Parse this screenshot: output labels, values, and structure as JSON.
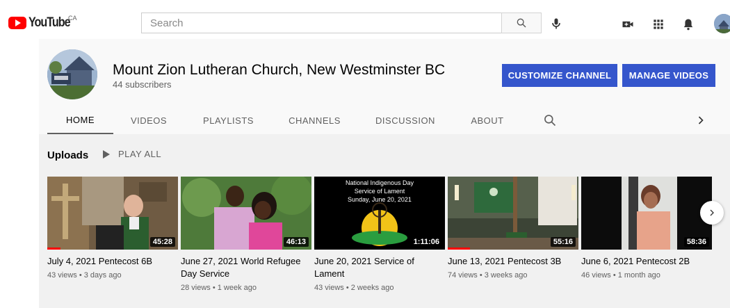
{
  "header": {
    "logo_text": "YouTube",
    "region": "CA",
    "search_placeholder": "Search"
  },
  "channel": {
    "name": "Mount Zion Lutheran Church, New Westminster BC",
    "subscribers": "44 subscribers",
    "customize_label": "CUSTOMIZE CHANNEL",
    "manage_label": "MANAGE VIDEOS"
  },
  "tabs": [
    {
      "label": "HOME",
      "active": true
    },
    {
      "label": "VIDEOS"
    },
    {
      "label": "PLAYLISTS"
    },
    {
      "label": "CHANNELS"
    },
    {
      "label": "DISCUSSION"
    },
    {
      "label": "ABOUT"
    }
  ],
  "uploads": {
    "title": "Uploads",
    "play_all": "PLAY ALL"
  },
  "videos": [
    {
      "title": "July 4, 2021 Pentecost 6B",
      "meta": "43 views • 3 days ago",
      "duration": "45:28",
      "watched": 0.1
    },
    {
      "title": "June 27, 2021 World Refugee Day Service",
      "meta": "28 views • 1 week ago",
      "duration": "46:13"
    },
    {
      "title": "June 20, 2021 Service of Lament",
      "meta": "43 views • 2 weeks ago",
      "duration": "1:11:06",
      "thumb_text": [
        "National Indigenous Day",
        "Service of Lament",
        "Sunday, June 20, 2021"
      ]
    },
    {
      "title": "June 13, 2021 Pentecost 3B",
      "meta": "74 views • 3 weeks ago",
      "duration": "55:16",
      "watched": 0.17
    },
    {
      "title": "June 6, 2021 Pentecost 2B",
      "meta": "46 views • 1 month ago",
      "duration": "58:36"
    }
  ],
  "colors": {
    "brand_red": "#ff0000",
    "button_blue": "#3556cc"
  }
}
